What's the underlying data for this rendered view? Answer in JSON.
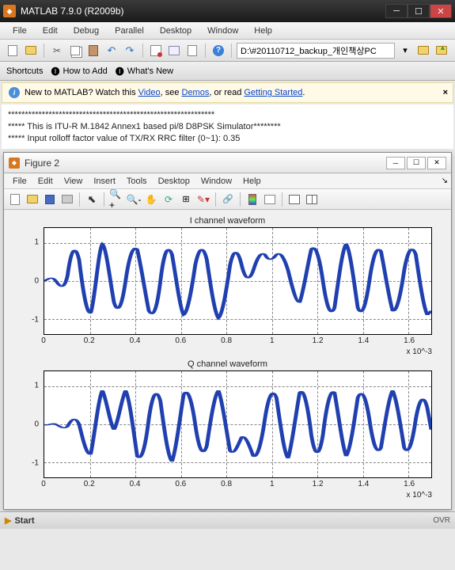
{
  "main_window": {
    "title": "MATLAB 7.9.0 (R2009b)",
    "menu": [
      "File",
      "Edit",
      "Debug",
      "Parallel",
      "Desktop",
      "Window",
      "Help"
    ],
    "path_field": "D:\\#20110712_backup_개인책상PC",
    "shortcuts": {
      "label": "Shortcuts",
      "how_to_add": "How to Add",
      "whats_new": "What's New"
    },
    "info_banner": {
      "prefix": "New to MATLAB? Watch this ",
      "video": "Video",
      "mid1": ", see ",
      "demos": "Demos",
      "mid2": ", or read ",
      "getting_started": "Getting Started",
      "suffix": "."
    },
    "cmd_lines": [
      "*************************************************************",
      "***** This is ITU-R M.1842 Annex1 based pi/8 D8PSK Simulator********",
      "***** Input rolloff factor value of TX/RX RRC filter (0~1): 0.35"
    ]
  },
  "figure_window": {
    "title": "Figure 2",
    "menu": [
      "File",
      "Edit",
      "View",
      "Insert",
      "Tools",
      "Desktop",
      "Window",
      "Help"
    ]
  },
  "chart_data": [
    {
      "type": "line",
      "title": "I channel waveform",
      "xlabel": "",
      "ylabel": "",
      "xlim": [
        0,
        0.0017
      ],
      "ylim": [
        -1.4,
        1.4
      ],
      "xticks": [
        0,
        0.2,
        0.4,
        0.6,
        0.8,
        1.0,
        1.2,
        1.4,
        1.6
      ],
      "xtick_scale": "x 10^-3",
      "yticks": [
        -1,
        0,
        1
      ],
      "series": [
        {
          "name": "I",
          "description": "continuous waveform oscillating approx between -1.2 and 1.2"
        }
      ]
    },
    {
      "type": "line",
      "title": "Q channel waveform",
      "xlabel": "",
      "ylabel": "",
      "xlim": [
        0,
        0.0017
      ],
      "ylim": [
        -1.4,
        1.4
      ],
      "xticks": [
        0,
        0.2,
        0.4,
        0.6,
        0.8,
        1.0,
        1.2,
        1.4,
        1.6
      ],
      "xtick_scale": "x 10^-3",
      "yticks": [
        -1,
        0,
        1
      ],
      "series": [
        {
          "name": "Q",
          "description": "continuous waveform oscillating approx between -1.2 and 1.2"
        }
      ]
    }
  ],
  "statusbar": {
    "start": "Start",
    "ovr": "OVR"
  }
}
